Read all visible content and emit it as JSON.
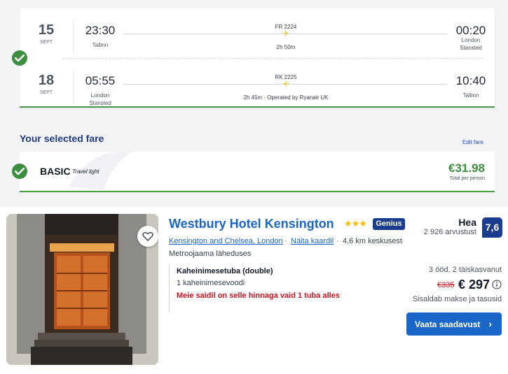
{
  "flights": [
    {
      "day": "15",
      "month": "SEPT",
      "dep_time": "23:30",
      "dep_place": "Tallinn",
      "flight_no": "FR 2224",
      "duration": "2h 50m",
      "arr_time": "00:20",
      "arr_place_1": "London",
      "arr_place_2": "Stansted"
    },
    {
      "day": "18",
      "month": "SEPT",
      "dep_time": "05:55",
      "dep_place_1": "London",
      "dep_place_2": "Stansted",
      "flight_no": "RK 2225",
      "duration": "2h 45m · Operated by Ryanair UK",
      "arr_time": "10:40",
      "arr_place": "Tallinn"
    }
  ],
  "fare": {
    "title": "Your selected fare",
    "edit": "Edit fare",
    "name": "BASIC",
    "tag": "Travel light",
    "price": "€31.98",
    "total_label": "Total per person"
  },
  "hotel": {
    "name": "Westbury Hotel Kensington",
    "stars": "★★★",
    "genius": "Genius",
    "location": "Kensington and Chelsea, London",
    "map_link": "Näita kaardil",
    "distance": "4,6 km keskusest",
    "metro": "Metroojaama läheduses",
    "room_type": "Kaheinimesetuba (double)",
    "bed": "1 kaheinimesevoodi",
    "scarcity": "Meie saidil on selle hinnaga vaid 1 tuba alles",
    "rating_word": "Hea",
    "reviews": "2 926 arvustust",
    "score": "7,6",
    "stay": "3 ööd, 2 täiskasvanut",
    "old_price": "€335",
    "new_price": "€ 297",
    "taxes": "Sisaldab makse ja tasusid",
    "button": "Vaata saadavust",
    "separator": "·"
  },
  "colors": {
    "brand_blue": "#1a66c9",
    "navy": "#1a3d8f",
    "green": "#3e8e41",
    "red": "#d4111e",
    "star": "#febb02"
  }
}
